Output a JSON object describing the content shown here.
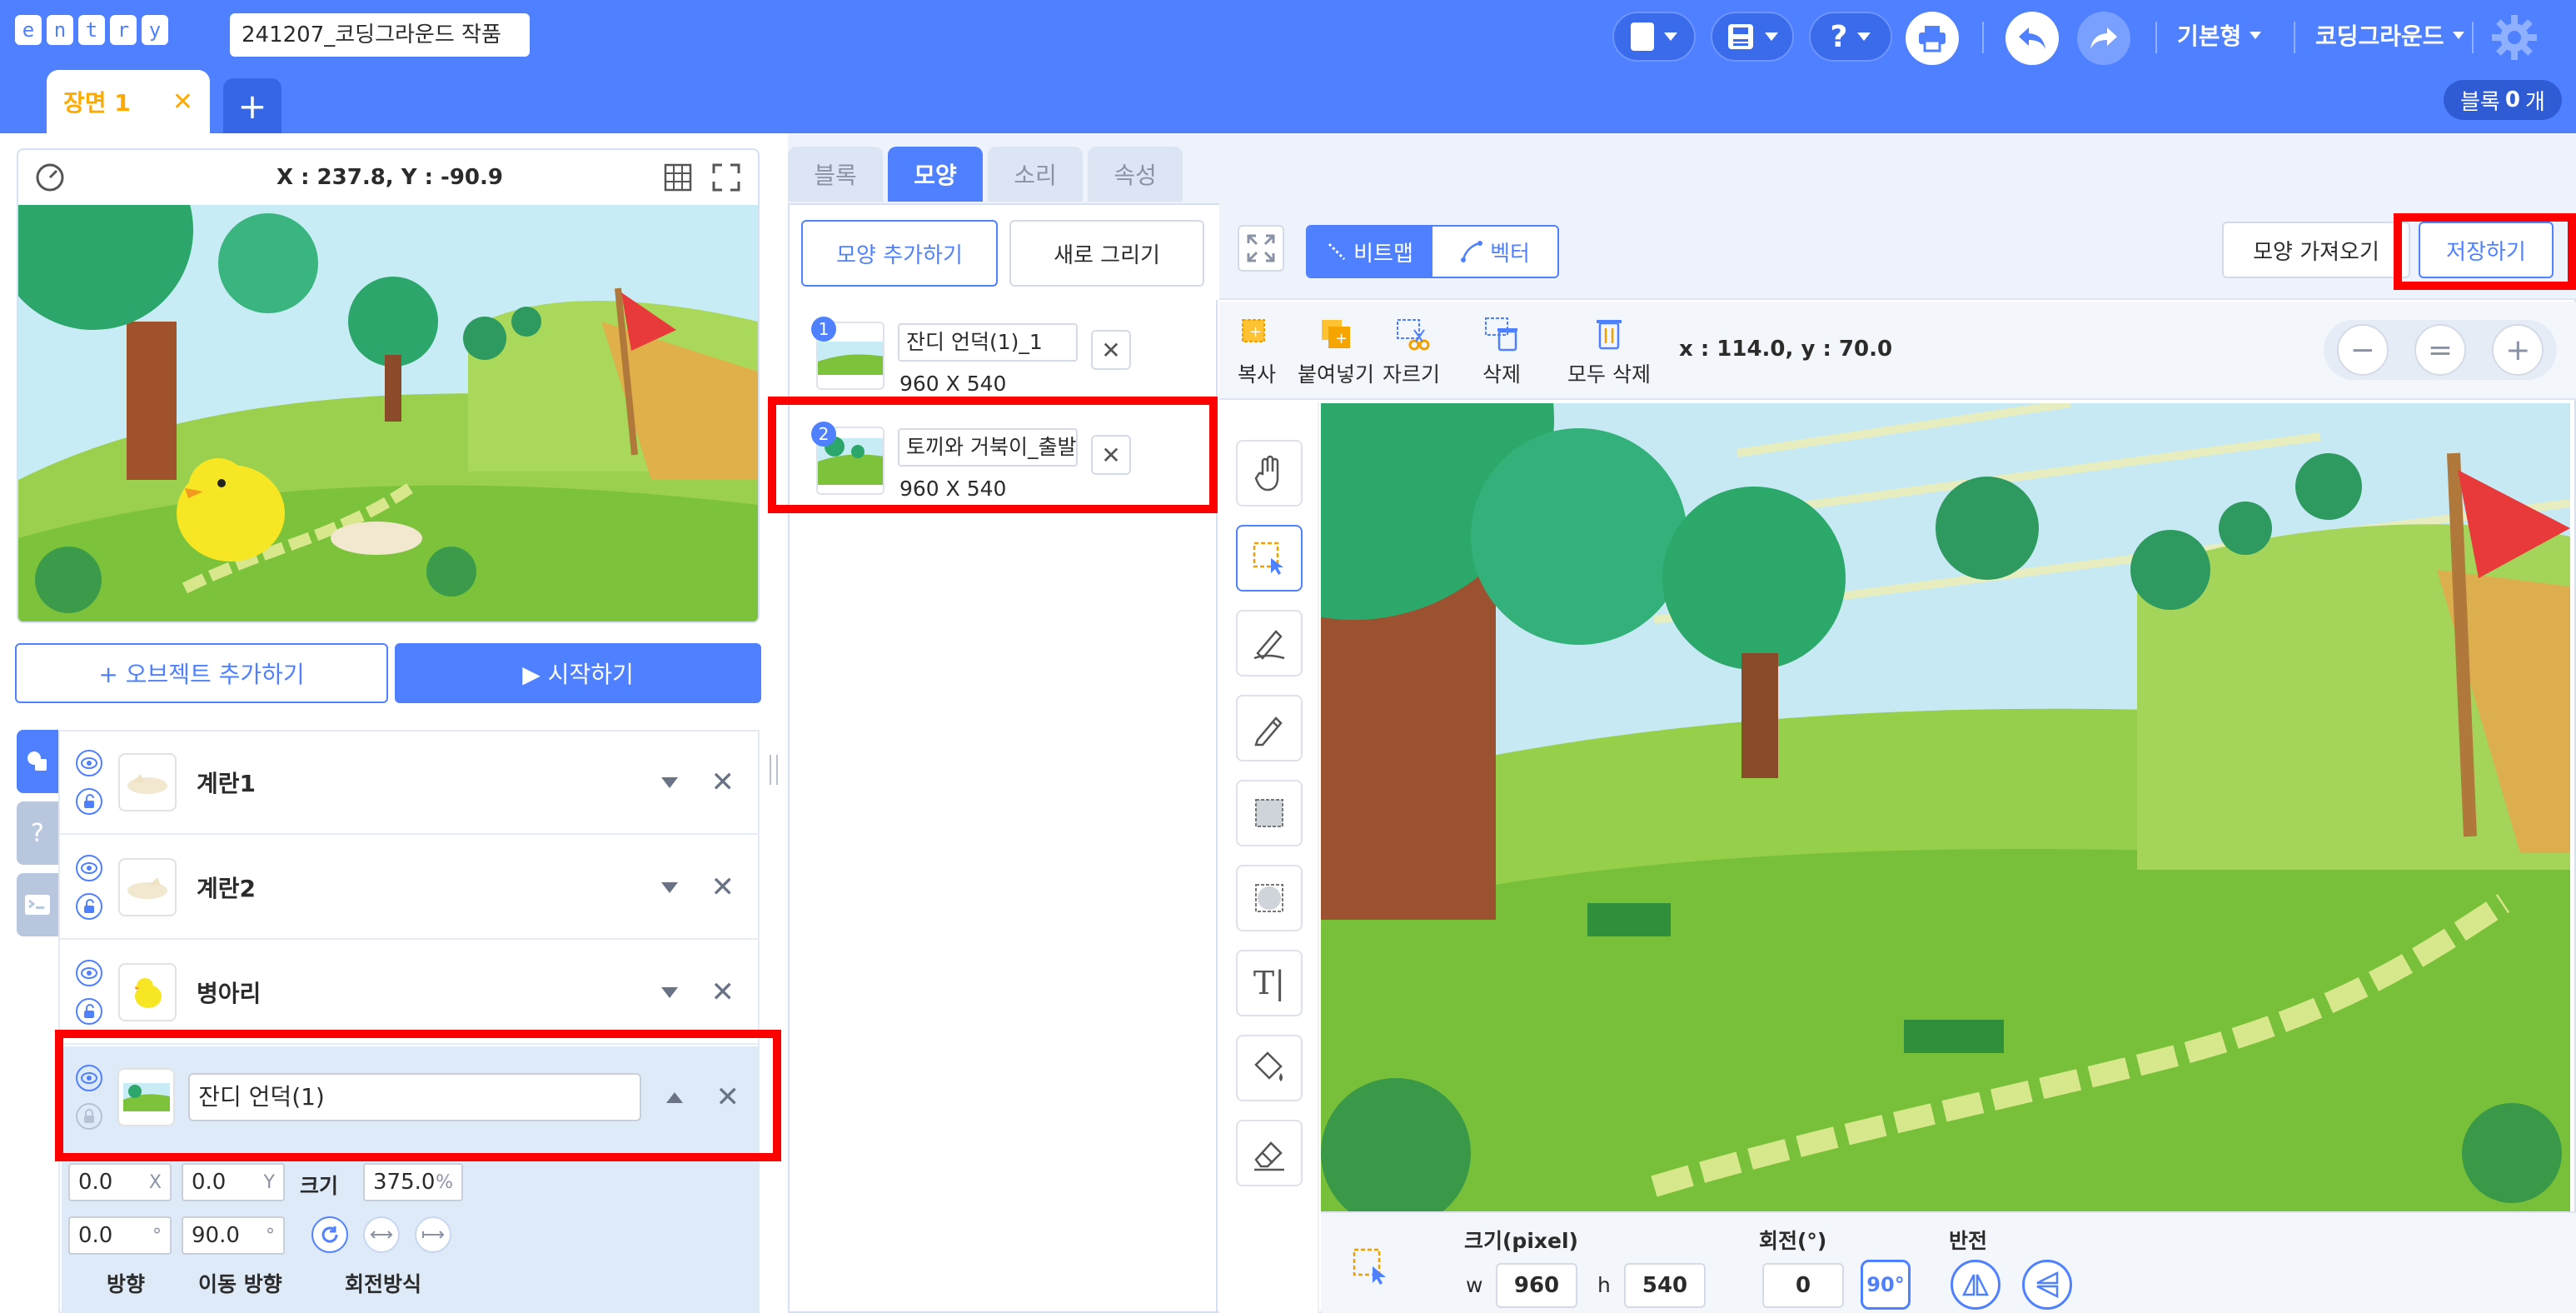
{
  "header": {
    "logo_letters": [
      "e",
      "n",
      "t",
      "r",
      "y"
    ],
    "project_name": "241207_코딩그라운드 작품",
    "menu_mode": "기본형",
    "menu_user": "코딩그라운드",
    "help_label": "?",
    "scene_tab": "장면 1",
    "scene_close": "✕",
    "add_scene": "+",
    "block_count_label": "블록",
    "block_count_value": "0",
    "block_count_unit": "개",
    "colors": {
      "bar": "#4f80ff",
      "scene_accent": "#ffaa00"
    }
  },
  "stage": {
    "coord_text": "X : 237.8, Y : -90.9",
    "add_object_button": "+ 오브젝트 추가하기",
    "start_button": "▶ 시작하기"
  },
  "side_tabs": {
    "help": "?"
  },
  "objects": [
    {
      "name": "계란1",
      "locked": false,
      "selected": false
    },
    {
      "name": "계란2",
      "locked": false,
      "selected": false
    },
    {
      "name": "병아리",
      "locked": false,
      "selected": false
    },
    {
      "name": "잔디 언덕(1)",
      "locked": true,
      "selected": true
    }
  ],
  "object_props": {
    "x_value": "0.0",
    "x_unit": "X",
    "y_value": "0.0",
    "y_unit": "Y",
    "size_label": "크기",
    "size_value": "375.0",
    "size_unit": "%",
    "direction_value": "0.0",
    "direction_unit": "°",
    "move_dir_value": "90.0",
    "move_dir_unit": "°",
    "direction_label": "방향",
    "move_dir_label": "이동 방향",
    "rotation_mode_label": "회전방식"
  },
  "editor_tabs": [
    {
      "label": "블록",
      "active": false
    },
    {
      "label": "모양",
      "active": true
    },
    {
      "label": "소리",
      "active": false
    },
    {
      "label": "속성",
      "active": false
    }
  ],
  "shape_panel": {
    "add_shape_button": "모양 추가하기",
    "new_draw_button": "새로 그리기",
    "shapes": [
      {
        "number": "1",
        "name": "잔디 언덕(1)_1",
        "size": "960 X 540"
      },
      {
        "number": "2",
        "name": "토끼와 거북이_출발점",
        "size": "960 X 540"
      }
    ]
  },
  "paint": {
    "mode_bitmap": "비트맵",
    "mode_vector": "벡터",
    "active_mode": "비트맵",
    "import_button": "모양 가져오기",
    "save_button": "저장하기",
    "edit_tools": [
      "복사",
      "붙여넣기",
      "자르기",
      "삭제",
      "모두 삭제"
    ],
    "cursor_coord": "x : 114.0, y : 70.0",
    "zoom_out": "−",
    "zoom_reset": "=",
    "zoom_in": "+",
    "text_tool_glyph": "T|",
    "size_label": "크기(pixel)",
    "w_label": "w",
    "w_value": "960",
    "h_label": "h",
    "h_value": "540",
    "rotate_label": "회전(°)",
    "rotate_value": "0",
    "rotate_90": "90°",
    "flip_label": "반전"
  }
}
